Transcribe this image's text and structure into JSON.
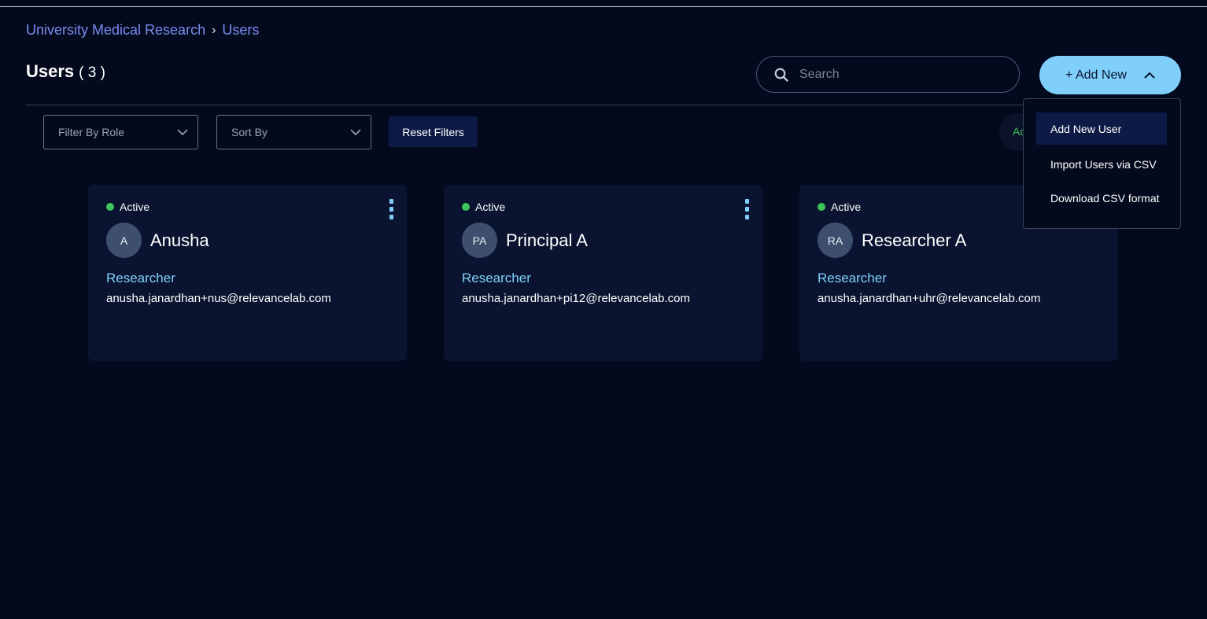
{
  "breadcrumb": {
    "org": "University Medical Research",
    "separator": "›",
    "current": "Users"
  },
  "header": {
    "title": "Users",
    "count": "( 3 )"
  },
  "search": {
    "placeholder": "Search",
    "icon": "search-icon"
  },
  "add_new": {
    "label": "+ Add New",
    "icon": "chevron-up-icon"
  },
  "menu": {
    "items": [
      {
        "label": "Add New User",
        "highlighted": true
      },
      {
        "label": "Import Users via CSV",
        "highlighted": false
      },
      {
        "label": "Download CSV format",
        "highlighted": false
      }
    ]
  },
  "filters": {
    "role_placeholder": "Filter By Role",
    "sort_placeholder": "Sort By",
    "reset_label": "Reset Filters",
    "toggle_partial_label": "Ac"
  },
  "users": [
    {
      "status": "Active",
      "initials": "A",
      "name": "Anusha",
      "role": "Researcher",
      "email": "anusha.janardhan+nus@relevancelab.com"
    },
    {
      "status": "Active",
      "initials": "PA",
      "name": "Principal A",
      "role": "Researcher",
      "email": "anusha.janardhan+pi12@relevancelab.com"
    },
    {
      "status": "Active",
      "initials": "RA",
      "name": "Researcher A",
      "role": "Researcher",
      "email": "anusha.janardhan+uhr@relevancelab.com"
    }
  ],
  "colors": {
    "background": "#040a1e",
    "card": "#0a1430",
    "accent": "#7fcffa",
    "breadcrumb_link": "#7a8cf0",
    "status_active": "#3ec45a"
  }
}
